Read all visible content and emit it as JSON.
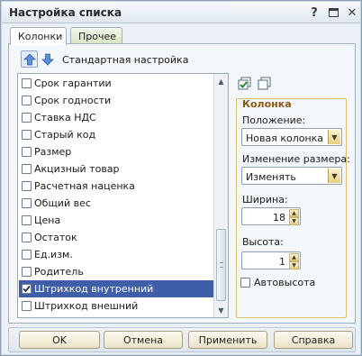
{
  "window": {
    "title": "Настройка списка",
    "help_glyph": "?",
    "close_glyph": "✕"
  },
  "tabs": [
    {
      "label": "Колонки",
      "active": true
    },
    {
      "label": "Прочее",
      "active": false
    }
  ],
  "toolbar": {
    "up_icon": "arrow-up-icon",
    "down_icon": "arrow-down-icon",
    "standard_setting_label": "Стандартная настройка"
  },
  "columns_list": {
    "items": [
      {
        "label": "Срок гарантии",
        "checked": false,
        "selected": false
      },
      {
        "label": "Срок годности",
        "checked": false,
        "selected": false
      },
      {
        "label": "Ставка НДС",
        "checked": false,
        "selected": false
      },
      {
        "label": "Старый код",
        "checked": false,
        "selected": false
      },
      {
        "label": "Размер",
        "checked": false,
        "selected": false
      },
      {
        "label": "Акцизный товар",
        "checked": false,
        "selected": false
      },
      {
        "label": "Расчетная наценка",
        "checked": false,
        "selected": false
      },
      {
        "label": "Общий вес",
        "checked": false,
        "selected": false
      },
      {
        "label": "Цена",
        "checked": false,
        "selected": false
      },
      {
        "label": "Остаток",
        "checked": false,
        "selected": false
      },
      {
        "label": "Ед.изм.",
        "checked": false,
        "selected": false
      },
      {
        "label": "Родитель",
        "checked": false,
        "selected": false
      },
      {
        "label": "Штрихкод внутренний",
        "checked": true,
        "selected": true
      },
      {
        "label": "Штрихкод внешний",
        "checked": false,
        "selected": false
      }
    ]
  },
  "column_panel": {
    "check_all_icon": "check-all-icon",
    "uncheck_all_icon": "uncheck-all-icon",
    "title": "Колонка",
    "position_label": "Положение:",
    "position_value": "Новая колонка",
    "resize_label": "Изменение размера:",
    "resize_value": "Изменять",
    "width_label": "Ширина:",
    "width_value": "18",
    "height_label": "Высота:",
    "height_value": "1",
    "auto_height_label": "Автовысота",
    "auto_height_checked": false
  },
  "buttons": {
    "ok": "OK",
    "cancel": "Отмена",
    "apply": "Применить",
    "help": "Справка"
  },
  "colors": {
    "selection": "#3f5ea8",
    "group_title": "#8a5a0f",
    "dropdown_button": "#e8cf7c"
  }
}
